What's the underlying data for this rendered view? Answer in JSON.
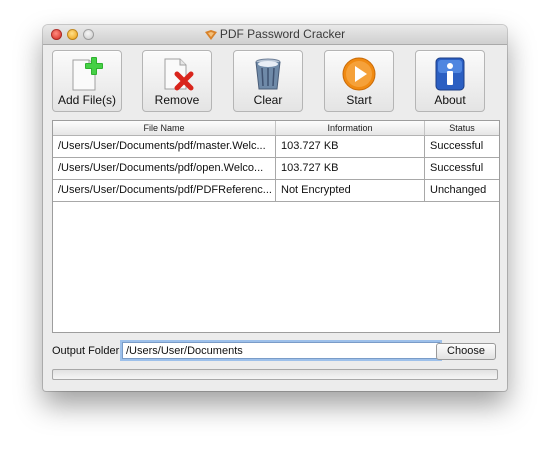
{
  "window": {
    "title": "PDF Password Cracker"
  },
  "toolbar": {
    "add_files": {
      "label": "Add File(s)",
      "icon": "add-file-icon"
    },
    "remove": {
      "label": "Remove",
      "icon": "remove-file-icon"
    },
    "clear": {
      "label": "Clear",
      "icon": "trash-icon"
    },
    "start": {
      "label": "Start",
      "icon": "play-icon"
    },
    "about": {
      "label": "About",
      "icon": "info-icon"
    }
  },
  "table": {
    "headers": [
      "File Name",
      "Information",
      "Status"
    ],
    "rows": [
      [
        "/Users/User/Documents/pdf/master.Welc...",
        "103.727 KB",
        "Successful"
      ],
      [
        "/Users/User/Documents/pdf/open.Welco...",
        "103.727 KB",
        "Successful"
      ],
      [
        "/Users/User/Documents/pdf/PDFReferenc...",
        "Not Encrypted",
        "Unchanged"
      ]
    ]
  },
  "output": {
    "label": "Output Folder",
    "value": "/Users/User/Documents",
    "choose_label": "Choose"
  },
  "progress": {
    "value": 0
  },
  "colors": {
    "accent": "#2b6fd6",
    "start_orange": "#f08a12",
    "remove_red": "#d9251c"
  }
}
